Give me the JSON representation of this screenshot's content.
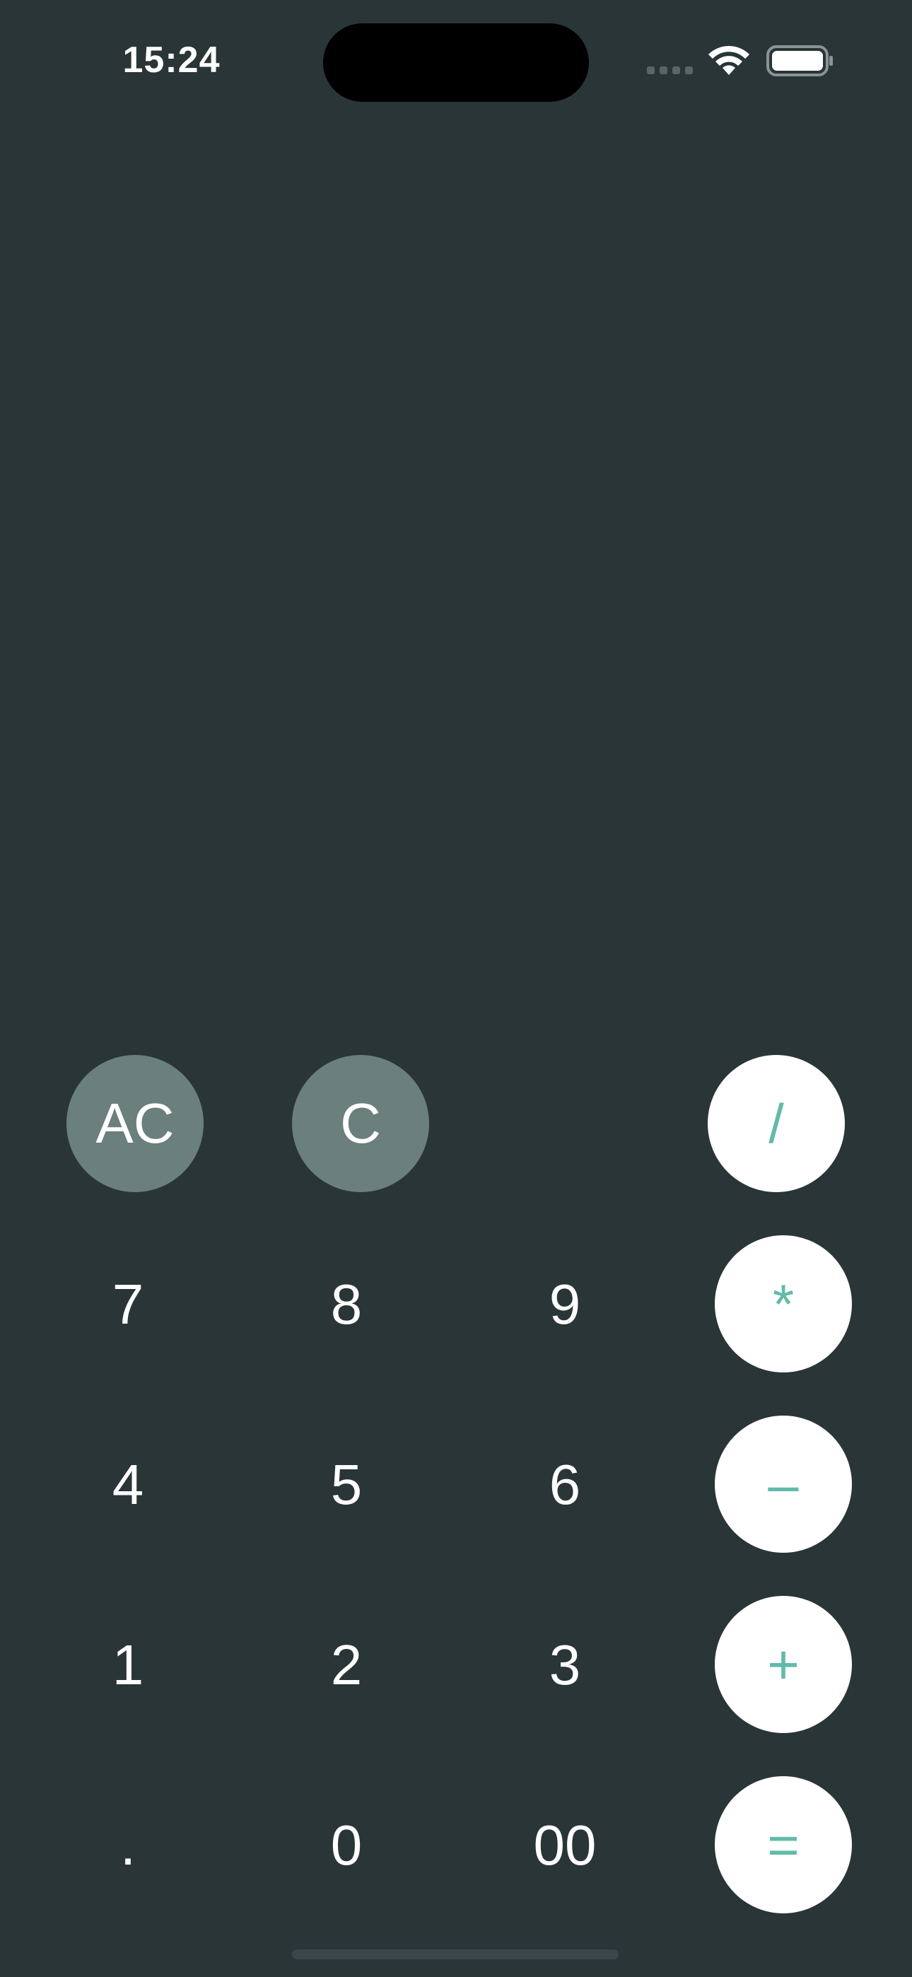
{
  "status_bar": {
    "time": "15:24",
    "signal_icon": "cellular-signal-icon",
    "wifi_icon": "wifi-icon",
    "battery_icon": "battery-icon"
  },
  "display": {
    "value": ""
  },
  "keypad": {
    "clear_all": "AC",
    "clear": "C",
    "divide": "/",
    "multiply": "*",
    "subtract": "–",
    "add": "+",
    "equals": "=",
    "seven": "7",
    "eight": "8",
    "nine": "9",
    "four": "4",
    "five": "5",
    "six": "6",
    "one": "1",
    "two": "2",
    "three": "3",
    "decimal": ".",
    "zero": "0",
    "double_zero": "00"
  },
  "colors": {
    "background": "#293537",
    "function_key": "#6b7f7d",
    "operator_key": "#ffffff",
    "operator_text": "#62bba9",
    "text": "#ffffff"
  }
}
